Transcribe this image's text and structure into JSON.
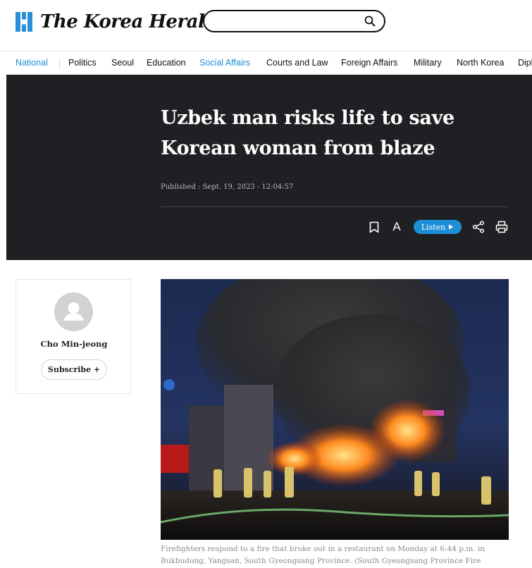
{
  "header": {
    "logo_text": "The Korea Herald",
    "search": {
      "value": "",
      "placeholder": ""
    }
  },
  "nav": {
    "items": [
      {
        "label": "National",
        "active": true
      },
      {
        "label": "Politics",
        "active": false
      },
      {
        "label": "Seoul",
        "active": false
      },
      {
        "label": "Education",
        "active": false
      },
      {
        "label": "Social Affairs",
        "active": true
      },
      {
        "label": "Courts and Law",
        "active": false
      },
      {
        "label": "Foreign Affairs",
        "active": false
      },
      {
        "label": "Military",
        "active": false
      },
      {
        "label": "North Korea",
        "active": false
      },
      {
        "label": "Diplomatic Circuit",
        "active": false
      }
    ]
  },
  "article": {
    "headline_line1": "Uzbek man risks life to save",
    "headline_line2": "Korean woman from blaze",
    "published": "Published : Sept. 19, 2023 - 12:04:57",
    "tools": {
      "bookmark_icon": "bookmark-icon",
      "font_size_label": "A",
      "listen_label": "Listen",
      "listen_icon": "play-icon",
      "share_icon": "share-icon",
      "print_icon": "print-icon"
    },
    "photo_caption": "Firefighters respond to a fire that broke out in a restaurant on Monday at 6:44 p.m. in Bukbudong, Yangsan, South Gyeongsang Province. (South Gyeongsang Province Fire"
  },
  "author": {
    "name": "Cho Min-jeong",
    "subscribe_label": "Subscribe +"
  },
  "colors": {
    "accent": "#1c8fd7",
    "hero_background": "#1f2023",
    "logo_blue": "#2b8fd8"
  }
}
